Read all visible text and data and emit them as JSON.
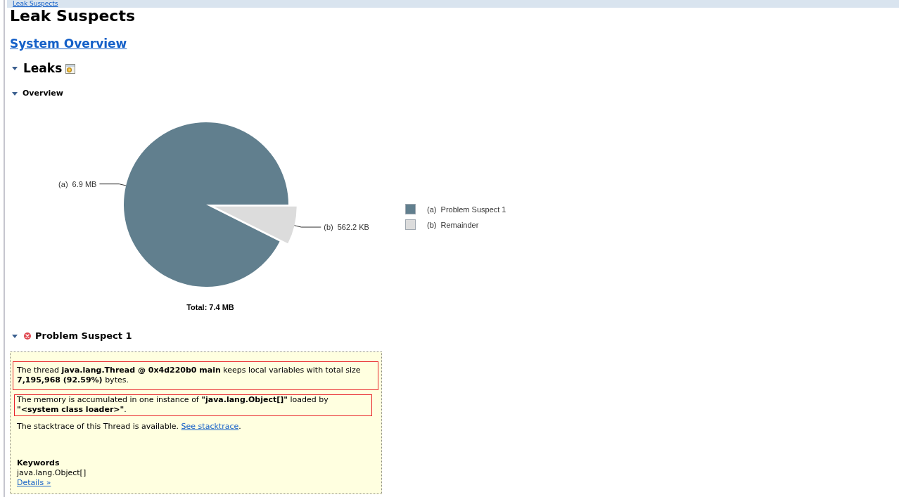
{
  "breadcrumb": {
    "link": "Leak Suspects"
  },
  "title": "Leak Suspects",
  "overview_link": "System Overview",
  "leaks": {
    "heading": "Leaks",
    "expanded": true,
    "overview": {
      "heading": "Overview",
      "expanded": true,
      "chart_data": {
        "type": "pie",
        "title": "Total: 7.4 MB",
        "categories": [
          "Problem Suspect 1",
          "Remainder"
        ],
        "values": [
          92.59,
          7.41
        ]
      },
      "slice_labels": [
        {
          "marker": "(a)",
          "size": "6.9 MB"
        },
        {
          "marker": "(b)",
          "size": "562.2 KB"
        }
      ],
      "legend": [
        {
          "marker": "(a)",
          "color": "#617f8e"
        },
        {
          "marker": "(b)",
          "color": "#dcdcdc"
        }
      ]
    },
    "suspects": [
      {
        "heading": "Problem Suspect 1",
        "expanded": true,
        "paragraphs": [
          {
            "text": "The thread **java.lang.Thread @ 0x4d220b0 main** keeps local variables with total size **7,195,968 (92.59%)** bytes.",
            "highlighted": true
          },
          {
            "text": "The memory is accumulated in one instance of **\"java.lang.Object[]\"** loaded by **\"<system class loader>\"**.",
            "highlighted": true
          },
          {
            "text": "The stacktrace of this Thread is available.",
            "highlighted": false,
            "link": "See stacktrace",
            "after": "."
          }
        ],
        "keywords_heading": "Keywords",
        "keywords": [
          "java.lang.Object[]"
        ],
        "details_link": "Details »"
      }
    ]
  }
}
